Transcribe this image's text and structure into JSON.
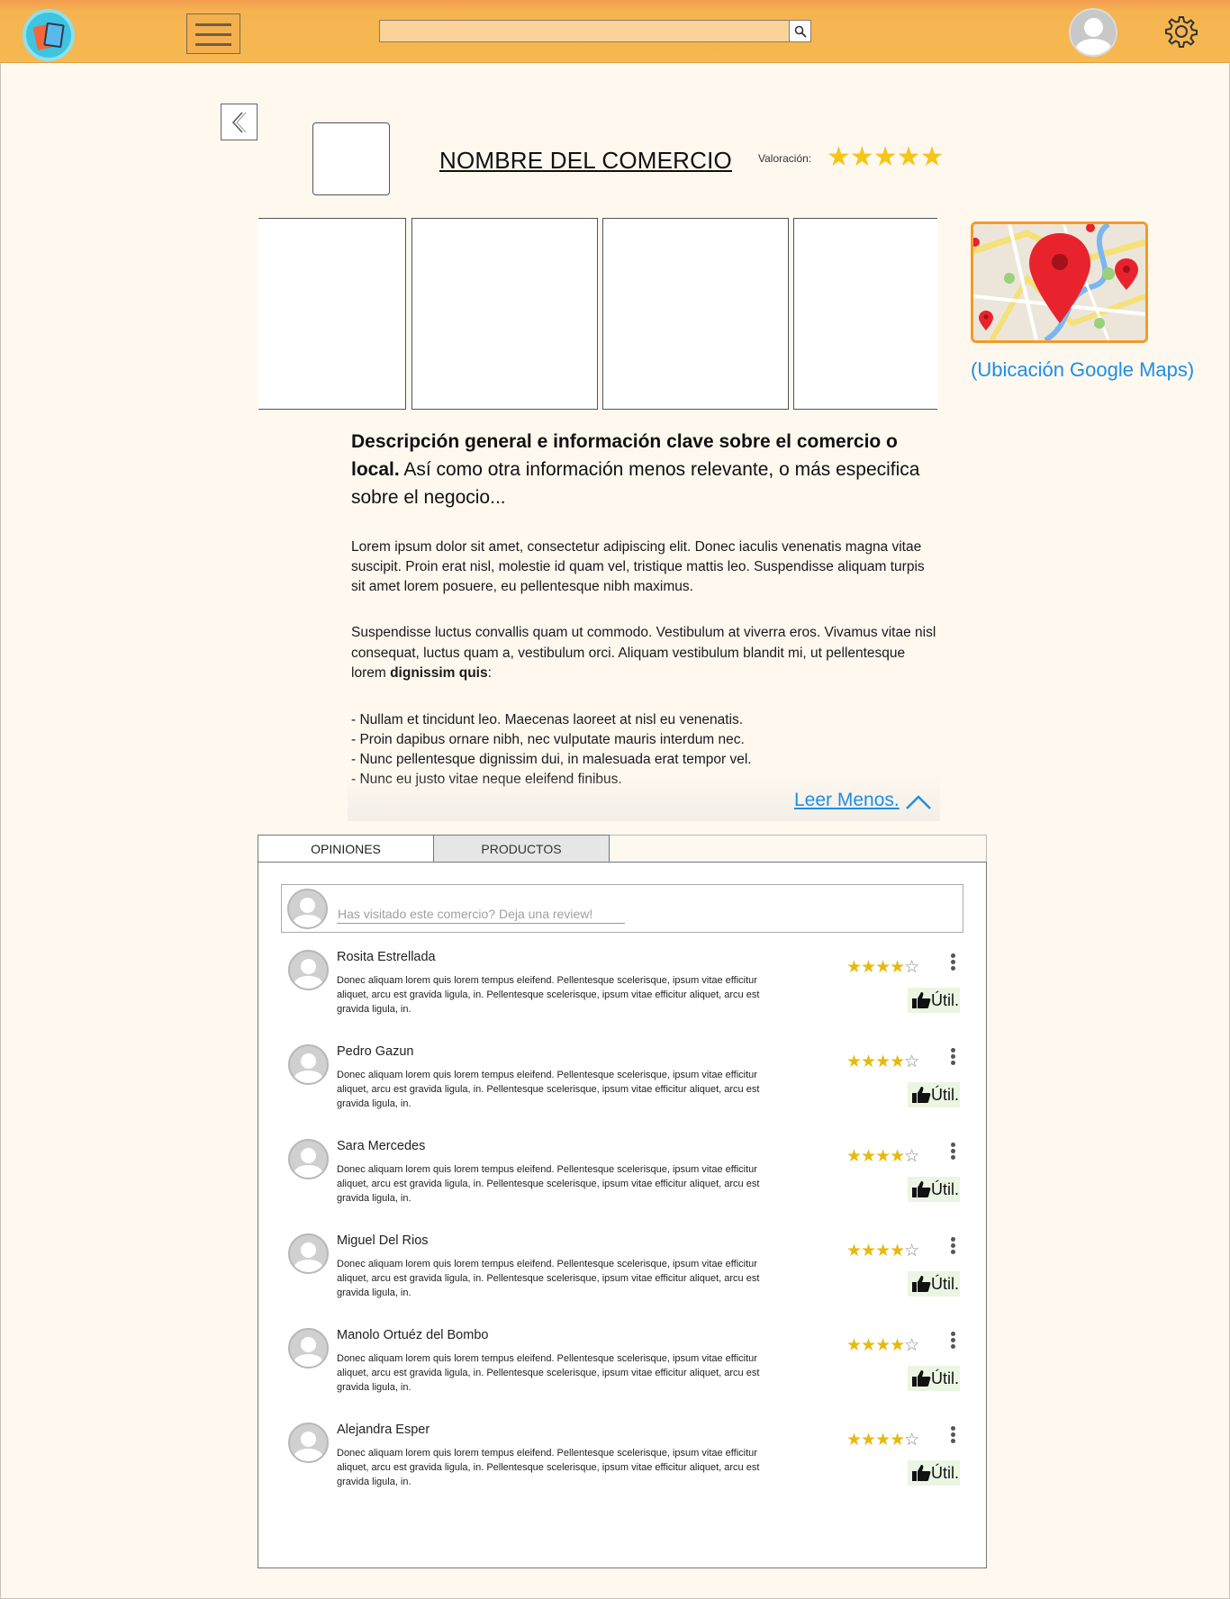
{
  "colors": {
    "topbar": "#f6b851",
    "link": "#1e8ee6",
    "star": "#f5c518",
    "map_border": "#f39a2b"
  },
  "header": {
    "logo_icon": "shopping-bags-icon",
    "menu_icon": "hamburger-icon",
    "search": {
      "value": "",
      "placeholder": "",
      "icon": "search-icon"
    },
    "user_icon": "user-avatar-icon",
    "settings_icon": "gear-icon"
  },
  "shop": {
    "back_icon": "chevron-left-icon",
    "name": "NOMBRE DEL COMERCIO",
    "rating_label": "Valoración:",
    "rating_stars": "★★★★★",
    "rating_value": 5,
    "map_link": "(Ubicación Google Maps)"
  },
  "description": {
    "lead_bold": "Descripción general e información clave sobre el comercio o local.",
    "lead_rest": " Así como otra información menos relevante, o más especifica sobre el negocio...",
    "p1": "Lorem ipsum dolor sit amet, consectetur adipiscing elit. Donec iaculis venenatis magna vitae suscipit. Proin erat nisl, molestie id quam vel, tristique mattis leo. Suspendisse aliquam turpis sit amet lorem posuere, eu pellentesque nibh maximus.",
    "p2_start": "Suspendisse luctus convallis quam ut commodo. Vestibulum at viverra eros. Vivamus vitae nisl consequat, luctus quam a, vestibulum orci. Aliquam vestibulum blandit mi, ut pellentesque lorem ",
    "p2_bold": "dignissim quis",
    "p2_end": ":",
    "bullets": [
      "- Nullam et tincidunt leo. Maecenas laoreet at nisl eu venenatis.",
      "- Proin dapibus ornare nibh, nec vulputate mauris interdum nec.",
      "- Nunc pellentesque dignissim dui, in malesuada erat tempor vel.",
      "- Nunc eu justo vitae neque eleifend finibus."
    ],
    "read_less": "Leer Menos.",
    "read_less_icon": "chevron-up-icon"
  },
  "tabs": [
    {
      "label": "OPINIONES",
      "active": true
    },
    {
      "label": "PRODUCTOS",
      "active": false
    }
  ],
  "review_prompt": {
    "placeholder": "Has visitado este comercio? Deja una review!"
  },
  "review_body": "Donec aliquam lorem quis lorem tempus eleifend. Pellentesque scelerisque, ipsum vitae efficitur aliquet, arcu est gravida ligula, in. Pellentesque scelerisque, ipsum vitae  efficitur aliquet, arcu est gravida ligula, in.",
  "useful_label": "Útil.",
  "reviews": [
    {
      "name": "Rosita Estrellada",
      "stars_on": "★★★★",
      "stars_off": "☆",
      "rating": 4
    },
    {
      "name": "Pedro Gazun",
      "stars_on": "★★★★",
      "stars_off": "☆",
      "rating": 4
    },
    {
      "name": "Sara Mercedes",
      "stars_on": "★★★★",
      "stars_off": "☆",
      "rating": 4
    },
    {
      "name": "Miguel Del Rios",
      "stars_on": "★★★★",
      "stars_off": "☆",
      "rating": 4
    },
    {
      "name": "Manolo Ortuéz del Bombo",
      "stars_on": "★★★★",
      "stars_off": "☆",
      "rating": 4
    },
    {
      "name": "Alejandra Esper",
      "stars_on": "★★★★",
      "stars_off": "☆",
      "rating": 4
    }
  ]
}
